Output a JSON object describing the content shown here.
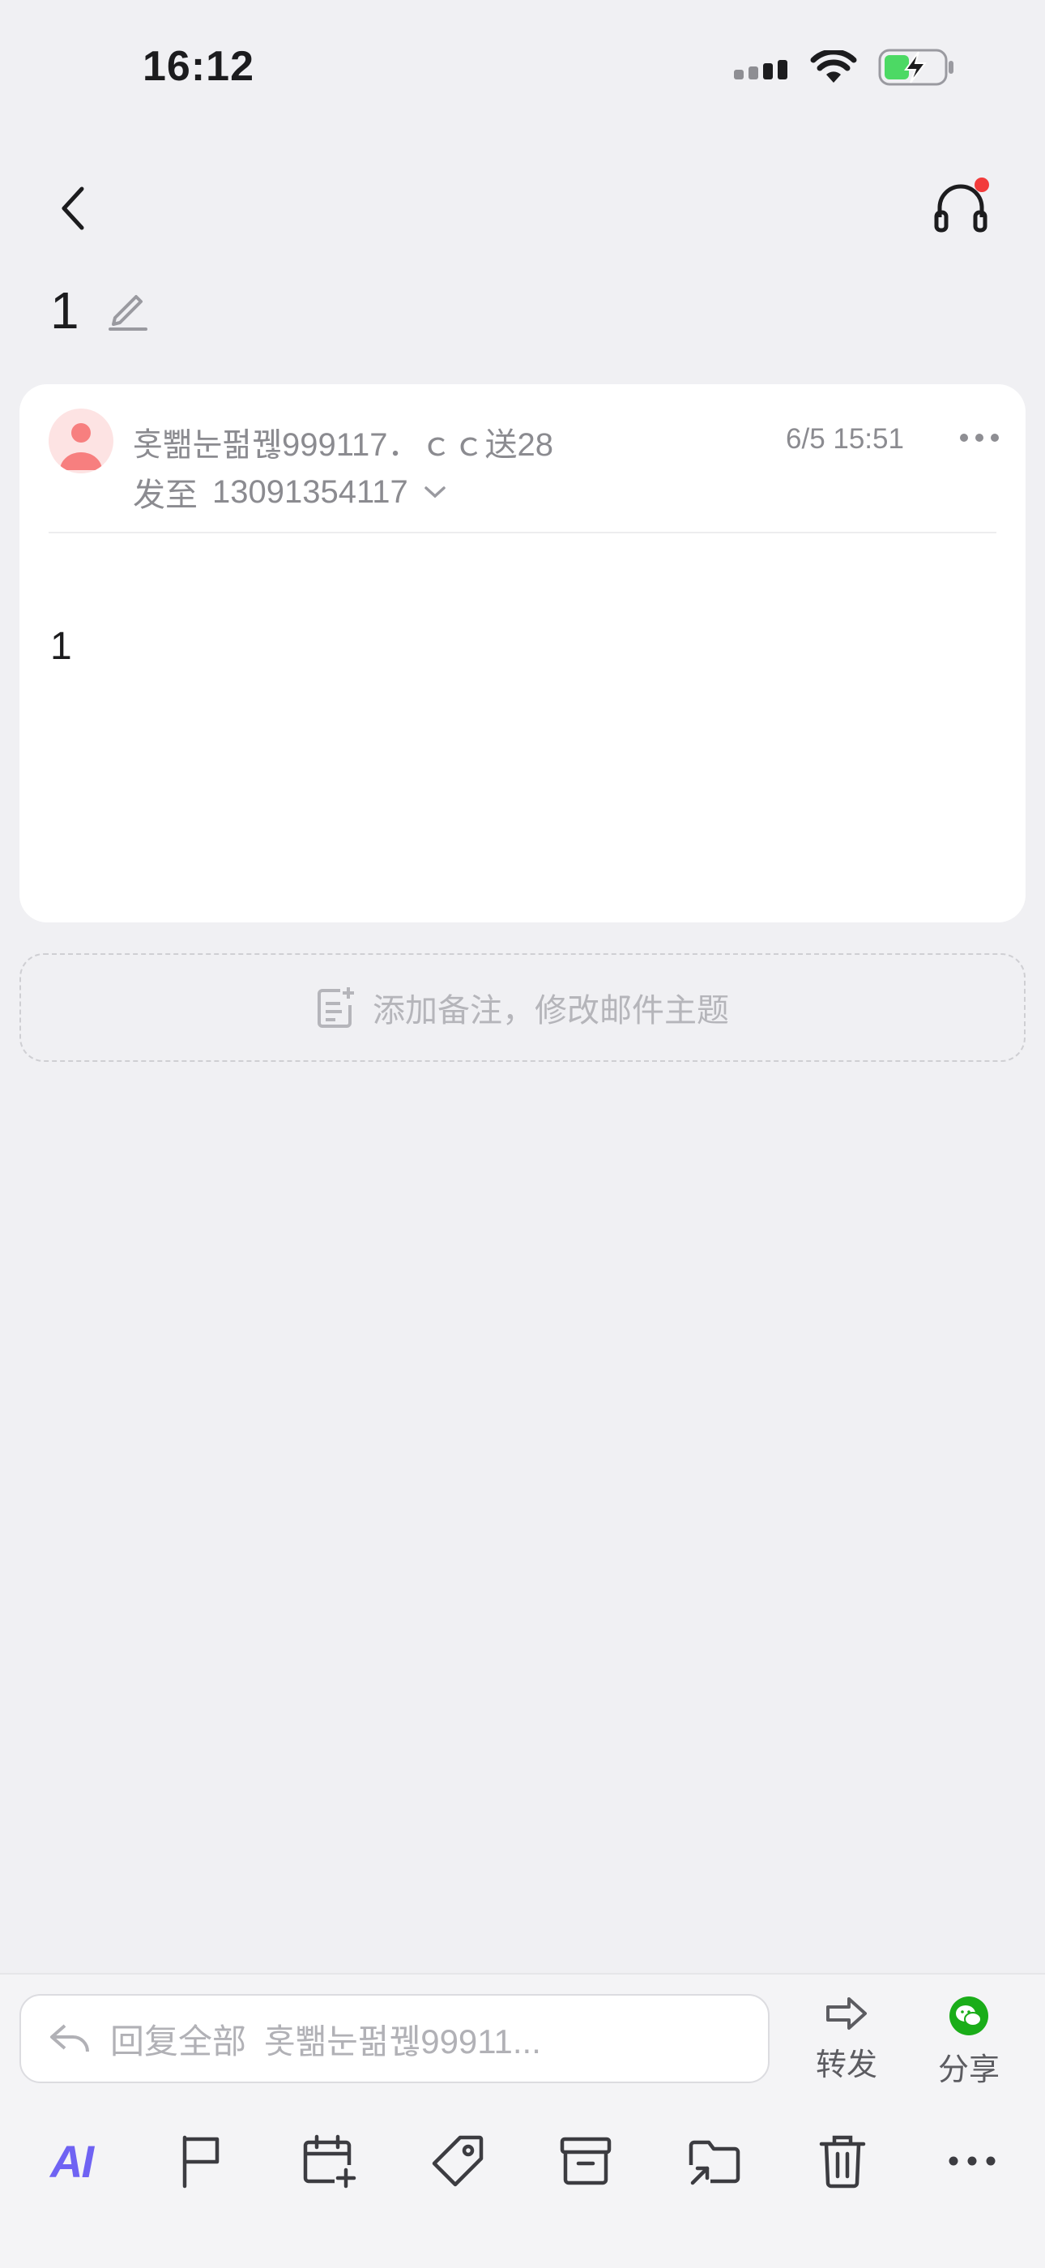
{
  "status": {
    "time": "16:12"
  },
  "header": {
    "back_icon": "chevron-left-icon",
    "headset_icon": "headset-icon",
    "headset_badge_color": "#f23b3b"
  },
  "subject": "1",
  "mail": {
    "sender": "홋뾂눈펆꿶999117．ｃｃ送28",
    "to_prefix": "发至",
    "to": "13091354117",
    "date": "6/5 15:51",
    "body": "1"
  },
  "note": {
    "label": "添加备注，修改邮件主题"
  },
  "reply": {
    "prefix": "回复全部",
    "name": "홋뾂눈펆꿶99911..."
  },
  "actions": {
    "forward": "转发",
    "share": "分享"
  },
  "toolbar": {
    "ai": "AI",
    "icons": [
      "flag-icon",
      "calendar-add-icon",
      "tag-icon",
      "archive-icon",
      "move-folder-icon",
      "trash-icon",
      "more-icon"
    ]
  },
  "colors": {
    "accent": "#6f63f3",
    "wechat": "#1aad19",
    "badge": "#f23b3b",
    "battery": "#4cd964"
  }
}
